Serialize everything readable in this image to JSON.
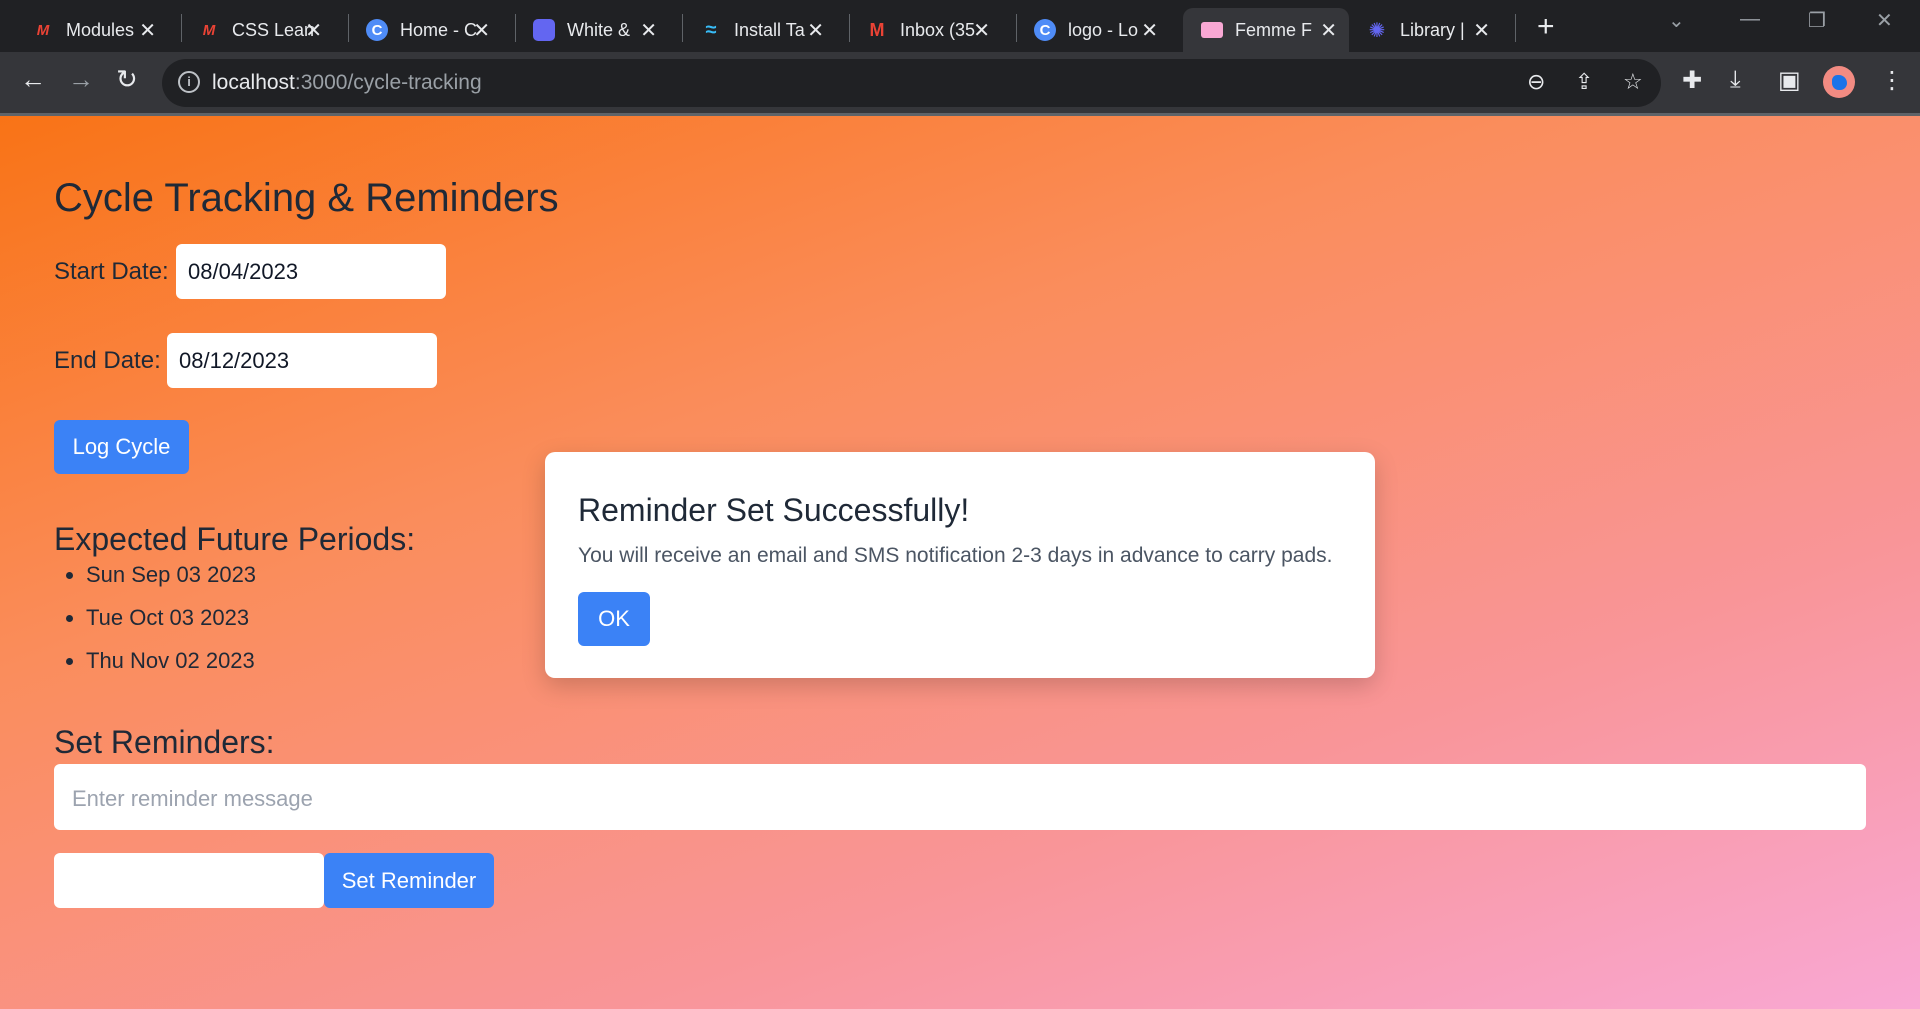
{
  "browser": {
    "tabs": [
      {
        "title": "Modules",
        "icon": "m-logo-icon",
        "color": "#ea4335"
      },
      {
        "title": "CSS Learn",
        "icon": "m-logo-icon",
        "color": "#ea4335"
      },
      {
        "title": "Home - C",
        "icon": "canva-icon",
        "color": "#4f8cf7"
      },
      {
        "title": "White &",
        "icon": "app-icon",
        "color": "#6366f1"
      },
      {
        "title": "Install Ta",
        "icon": "tailwind-icon",
        "color": "#38bdf8"
      },
      {
        "title": "Inbox (35",
        "icon": "gmail-icon",
        "color": "#ea4335"
      },
      {
        "title": "logo - Lo",
        "icon": "canva-icon",
        "color": "#4f8cf7"
      },
      {
        "title": "Femme F",
        "icon": "page-icon",
        "color": "#f9a8d4"
      },
      {
        "title": "Library |",
        "icon": "gear-logo-icon",
        "color": "#6366f1"
      }
    ],
    "url_host": "localhost",
    "url_path": ":3000/cycle-tracking"
  },
  "page": {
    "title": "Cycle Tracking & Reminders",
    "start_label": "Start Date:",
    "start_value": "08/04/2023",
    "end_label": "End Date:",
    "end_value": "08/12/2023",
    "log_button": "Log Cycle",
    "expected_heading": "Expected Future Periods:",
    "periods": [
      "Sun Sep 03 2023",
      "Tue Oct 03 2023",
      "Thu Nov 02 2023"
    ],
    "reminders_heading": "Set Reminders:",
    "reminder_placeholder": "Enter reminder message",
    "set_reminder_button": "Set Reminder"
  },
  "modal": {
    "title": "Reminder Set Successfully!",
    "text": "You will receive an email and SMS notification 2-3 days in advance to carry pads.",
    "ok_button": "OK"
  },
  "colors": {
    "accent": "#3b82f6",
    "gradient_start": "#f97316",
    "gradient_end": "#f9a8d4"
  }
}
